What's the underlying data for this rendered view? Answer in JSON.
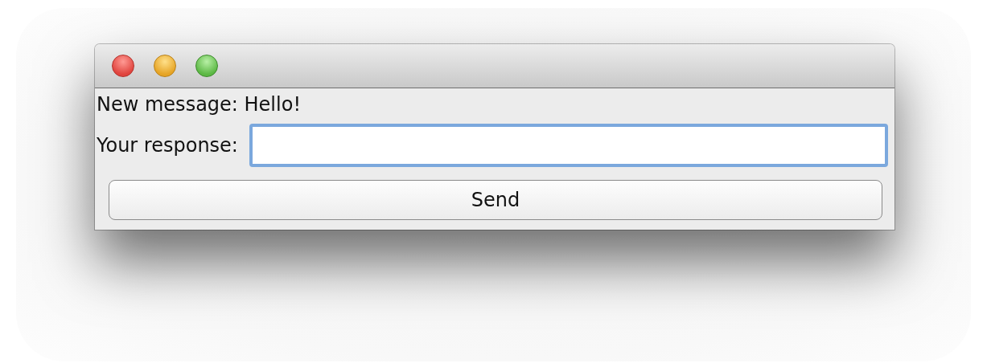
{
  "message_label": "New message: Hello!",
  "response_label": "Your response:",
  "response_field": {
    "focused": true
  },
  "send_button": "Send"
}
